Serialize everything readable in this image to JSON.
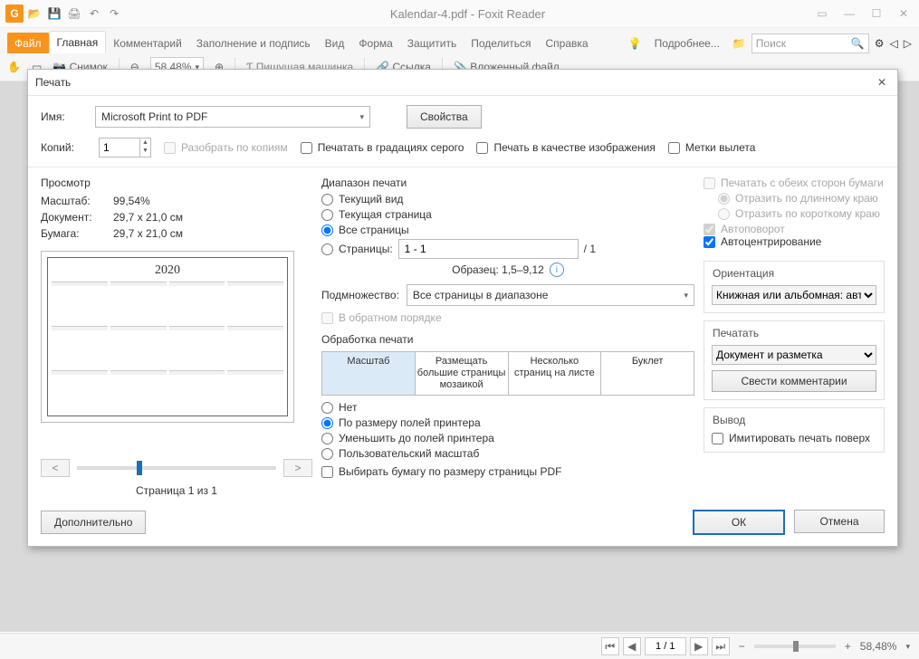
{
  "app": {
    "title": "Kalendar-4.pdf - Foxit Reader"
  },
  "ribbon": {
    "file": "Файл",
    "tabs": [
      "Главная",
      "Комментарий",
      "Заполнение и подпись",
      "Вид",
      "Форма",
      "Защитить",
      "Поделиться",
      "Справка"
    ],
    "more": "Подробнее...",
    "search_placeholder": "Поиск",
    "tool_snapshot": "Снимок",
    "tool_zoom": "58.48%",
    "tool_typewriter": "Пишущая машинка",
    "tool_link": "Ссылка",
    "tool_attach": "Вложенный файл"
  },
  "statusbar": {
    "page_field": "1 / 1",
    "zoom": "58,48%"
  },
  "dialog": {
    "title": "Печать",
    "name_label": "Имя:",
    "printer": "Microsoft Print to PDF",
    "properties": "Свойства",
    "copies_label": "Копий:",
    "copies_value": "1",
    "collate": "Разобрать по копиям",
    "grayscale": "Печатать в градациях серого",
    "as_image": "Печать в качестве изображения",
    "bleed": "Метки вылета",
    "preview": {
      "title": "Просмотр",
      "scale_label": "Масштаб:",
      "scale_value": "99,54%",
      "doc_label": "Документ:",
      "doc_value": "29,7 x 21,0 см",
      "paper_label": "Бумага:",
      "paper_value": "29,7 x 21,0 см",
      "year": "2020",
      "page_indicator": "Страница 1 из 1"
    },
    "range": {
      "title": "Диапазон печати",
      "current_view": "Текущий вид",
      "current_page": "Текущая страница",
      "all_pages": "Все страницы",
      "pages_label": "Страницы:",
      "pages_value": "1 - 1",
      "pages_of": "/ 1",
      "sample": "Образец: 1,5–9,12",
      "subset_label": "Подмножество:",
      "subset_value": "Все страницы в диапазоне",
      "reverse": "В обратном порядке"
    },
    "handling": {
      "title": "Обработка печати",
      "tab_scale": "Масштаб",
      "tab_tile": "Размещать большие страницы мозаикой",
      "tab_nup": "Несколько страниц на листе",
      "tab_booklet": "Буклет",
      "opt_none": "Нет",
      "opt_fit": "По размеру полей принтера",
      "opt_shrink": "Уменьшить до полей принтера",
      "opt_custom": "Пользовательский масштаб",
      "opt_choose_paper": "Выбирать бумагу по размеру страницы PDF"
    },
    "right": {
      "duplex": "Печатать с обеих сторон бумаги",
      "flip_long": "Отразить по длинному краю",
      "flip_short": "Отразить по короткому краю",
      "auto_rotate": "Автоповорот",
      "auto_center": "Автоцентрирование",
      "orient_title": "Ориентация",
      "orient_value": "Книжная или альбомная: авто",
      "print_title": "Печатать",
      "print_value": "Документ и разметка",
      "summarize": "Свести комментарии",
      "output_title": "Вывод",
      "simulate": "Имитировать печать поверх"
    },
    "advanced": "Дополнительно",
    "ok": "ОК",
    "cancel": "Отмена"
  }
}
